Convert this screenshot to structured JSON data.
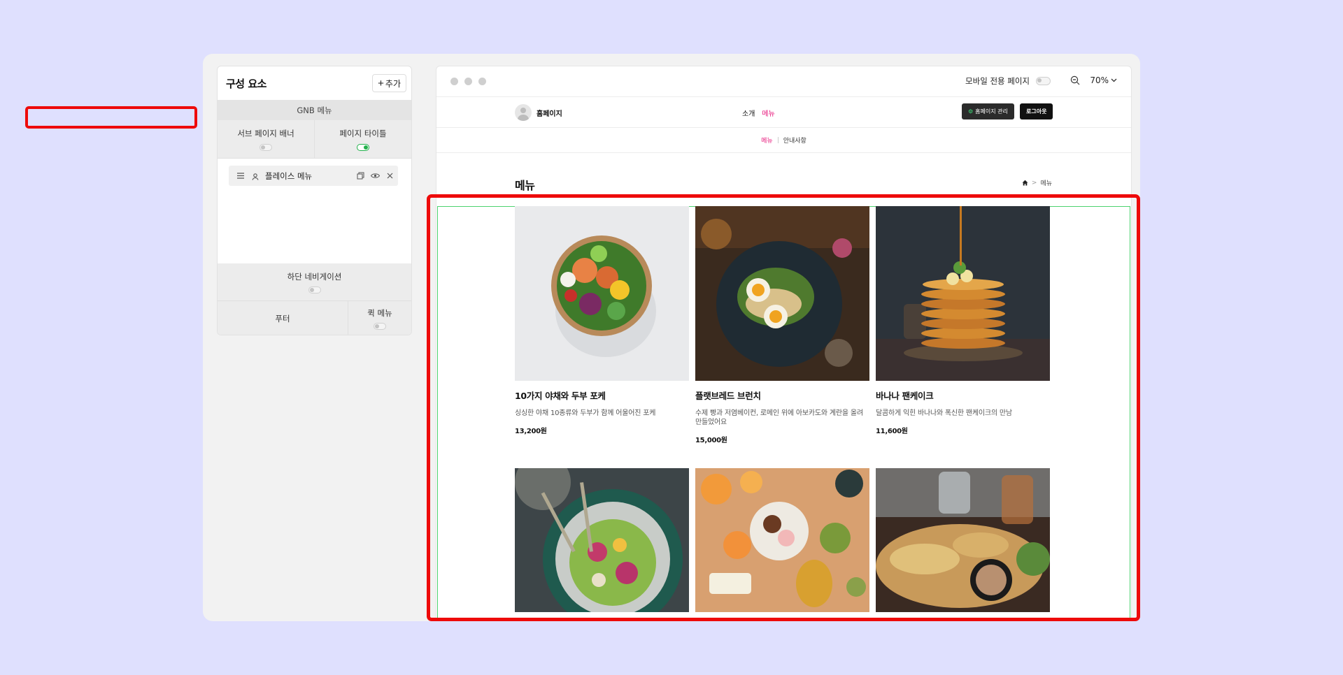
{
  "panel": {
    "title": "구성 요소",
    "add_label": "추가",
    "gnb_label": "GNB 메뉴",
    "sub_banner_label": "서브 페이지 배너",
    "page_title_label": "페이지 타이틀",
    "component_label": "플레이스 메뉴",
    "bottom_nav_label": "하단 네비게이션",
    "footer_label": "푸터",
    "quick_menu_label": "퀵 메뉴"
  },
  "window": {
    "mobile_label": "모바일 전용 페이지",
    "zoom": "70%"
  },
  "site": {
    "brand": "홈페이지",
    "nav": [
      "소개",
      "메뉴"
    ],
    "admin_button": "홈페이지 관리",
    "logout_button": "로그아웃",
    "subnav": [
      "메뉴",
      "안내사항"
    ],
    "page_title": "메뉴",
    "breadcrumb": "메뉴"
  },
  "menu_items": [
    {
      "title": "10가지 야채와 두부 포케",
      "desc": "싱싱한 야채 10종류와 두부가 함께 어울어진 포케",
      "price": "13,200원"
    },
    {
      "title": "플랫브레드 브런치",
      "desc": "수제 빵과 저염베이컨, 로메인 위에 아보카도와 계란을 올려 만들었어요",
      "price": "15,000원"
    },
    {
      "title": "바나나 팬케이크",
      "desc": "달콤하게 익힌 바나나와 폭신한 팬케이크의 만남",
      "price": "11,600원"
    }
  ],
  "colors": {
    "background": "#dfe0fe",
    "accent_pink": "#e6157a",
    "highlight_red": "#ee0a0a",
    "toggle_green": "#22b14c"
  }
}
